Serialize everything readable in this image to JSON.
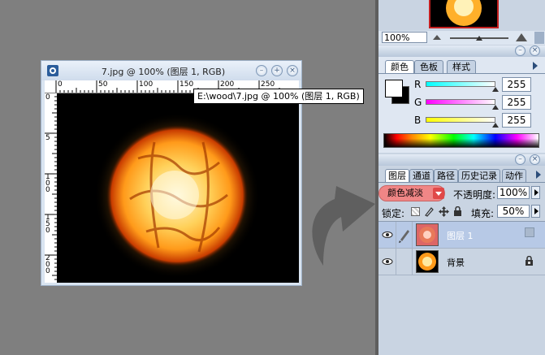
{
  "document_window": {
    "title": "7.jpg @ 100% (图层 1, RGB)",
    "ruler_top_labels": [
      "0",
      "50",
      "100",
      "150",
      "200",
      "250"
    ],
    "ruler_left_labels": [
      "0",
      "5",
      "1 0 0",
      "1 5 0",
      "2 0 0"
    ],
    "tooltip": "E:\\wood\\7.jpg @ 100% (图层 1, RGB)"
  },
  "navigator": {
    "zoom": "100%"
  },
  "color_palette": {
    "tabs": [
      "颜色",
      "色板",
      "样式"
    ],
    "active_tab": "颜色",
    "channels": [
      {
        "label": "R",
        "value": "255",
        "color": "#00e6e6"
      },
      {
        "label": "G",
        "value": "255",
        "color": "#ff00ff"
      },
      {
        "label": "B",
        "value": "255",
        "color": "#ffff00"
      }
    ]
  },
  "layers_palette": {
    "tabs": [
      "图层",
      "通道",
      "路径",
      "历史记录",
      "动作"
    ],
    "active_tab": "图层",
    "blend_mode": "颜色减淡",
    "opacity_label": "不透明度:",
    "opacity_value": "100%",
    "lock_label": "锁定:",
    "fill_label": "填充:",
    "fill_value": "50%",
    "layers": [
      {
        "name": "图层 1",
        "selected": true,
        "thumb": "reddish"
      },
      {
        "name": "背景",
        "selected": false,
        "thumb": "fire"
      }
    ]
  },
  "colors": {
    "selected_layer_bg": "#b7c9e6",
    "blend_highlight": "#f08686",
    "workspace_bg": "#7f7f7f"
  }
}
